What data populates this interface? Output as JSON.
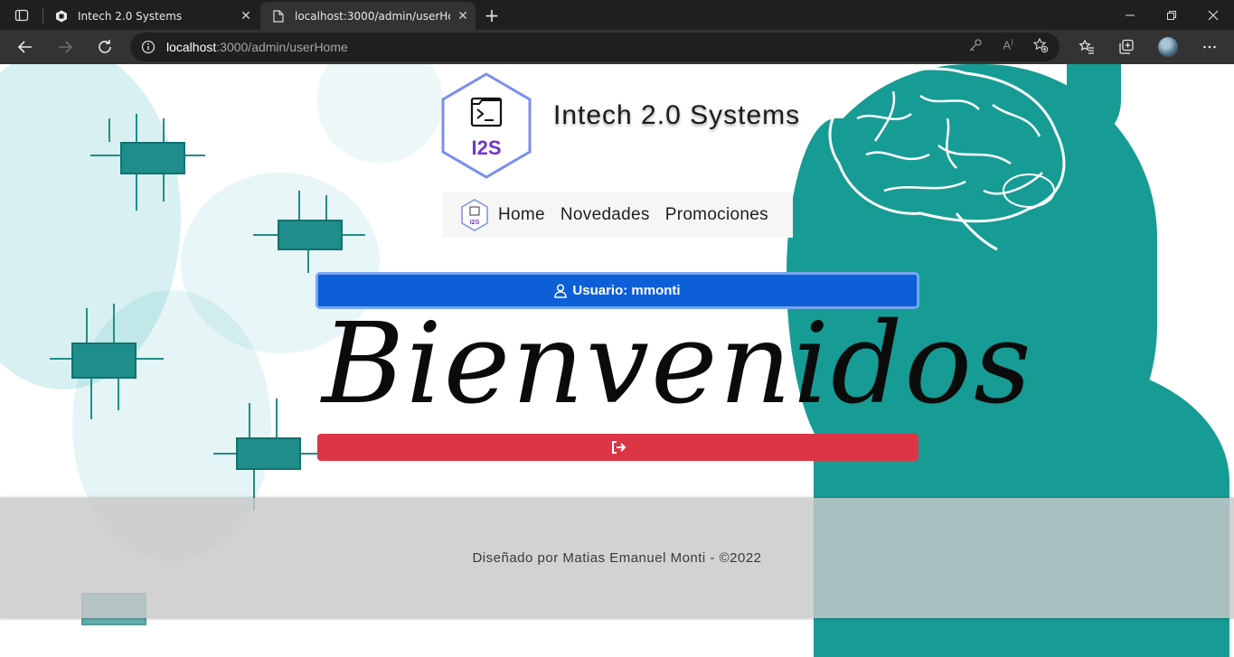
{
  "browser": {
    "tabs": [
      {
        "title": "Intech 2.0 Systems",
        "icon": "site-hexagon-icon",
        "active": false
      },
      {
        "title": "localhost:3000/admin/userHome",
        "icon": "page-icon",
        "active": true
      }
    ],
    "address": {
      "host": "localhost",
      "rest": ":3000/admin/userHome"
    },
    "toolbar_icons": [
      "back-icon",
      "forward-icon",
      "refresh-icon",
      "info-icon",
      "key-icon",
      "read-aloud-icon",
      "add-favorite-icon",
      "favorites-icon",
      "collections-icon",
      "profile-avatar",
      "more-icon"
    ]
  },
  "site": {
    "brand": "Intech 2.0 Systems",
    "logo_text": "I2S",
    "nav": [
      "Home",
      "Novedades",
      "Promociones"
    ]
  },
  "main": {
    "user_button": "Usuario: mmonti",
    "welcome": "Bienvenidos",
    "logout_icon": "logout-icon"
  },
  "footer": {
    "text": "Diseñado por Matias Emanuel Monti - ©2022"
  },
  "colors": {
    "primary": "#0d5fd8",
    "danger": "#dc3545",
    "teal": "#179c95",
    "logo_border": "#7b8ff0",
    "logo_text": "#6f36c9"
  }
}
